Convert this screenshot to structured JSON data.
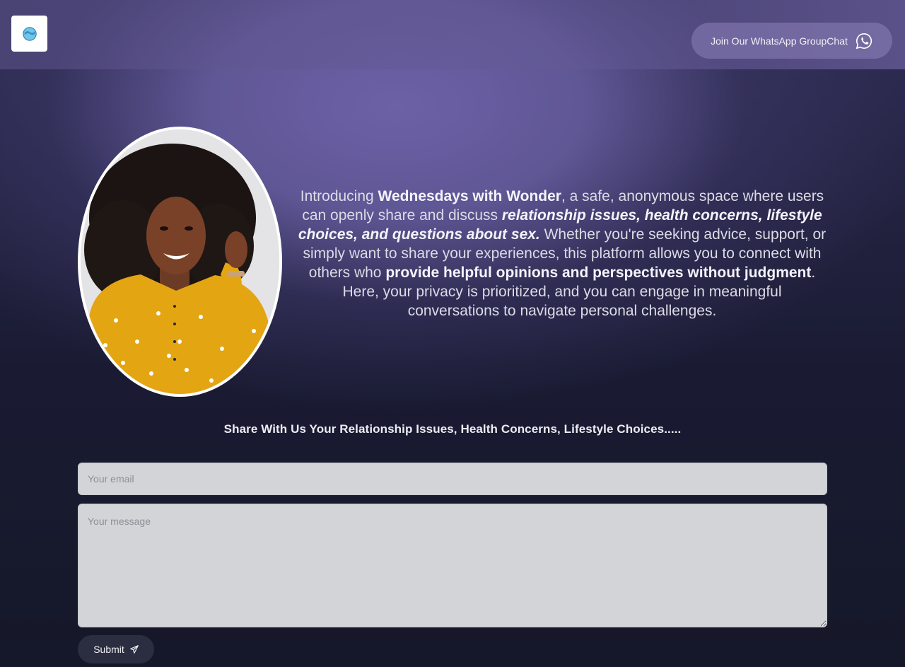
{
  "header": {
    "logo_icon": "globe-logo-icon",
    "whatsapp_button": {
      "label": "Join Our WhatsApp GroupChat",
      "icon": "whatsapp-icon"
    }
  },
  "hero": {
    "portrait_icon": "woman-portrait-photo",
    "intro": {
      "p1": "Introducing ",
      "b1": "Wednesdays with Wonder",
      "p2": ", a safe, anonymous space where users can openly share and discuss ",
      "bi1": "relationship issues, health concerns, lifestyle choices, and questions about sex.",
      "p3": " Whether you're seeking advice, support, or simply want to share your experiences, this platform allows you to connect with others who ",
      "b2": "provide helpful opinions and perspectives without judgment",
      "p4": ". Here, your privacy is prioritized, and you can engage in meaningful conversations to navigate personal challenges."
    }
  },
  "form": {
    "heading": "Share With Us Your Relationship Issues, Health Concerns, Lifestyle Choices.....",
    "email_placeholder": "Your email",
    "email_value": "",
    "message_placeholder": "Your message",
    "message_value": "",
    "submit_label": "Submit",
    "submit_icon": "send-icon"
  },
  "colors": {
    "background_dark": "#141728",
    "glow_purple": "#6e62a8",
    "input_bg": "#d3d4d8",
    "button_dark": "#2b2e40"
  }
}
